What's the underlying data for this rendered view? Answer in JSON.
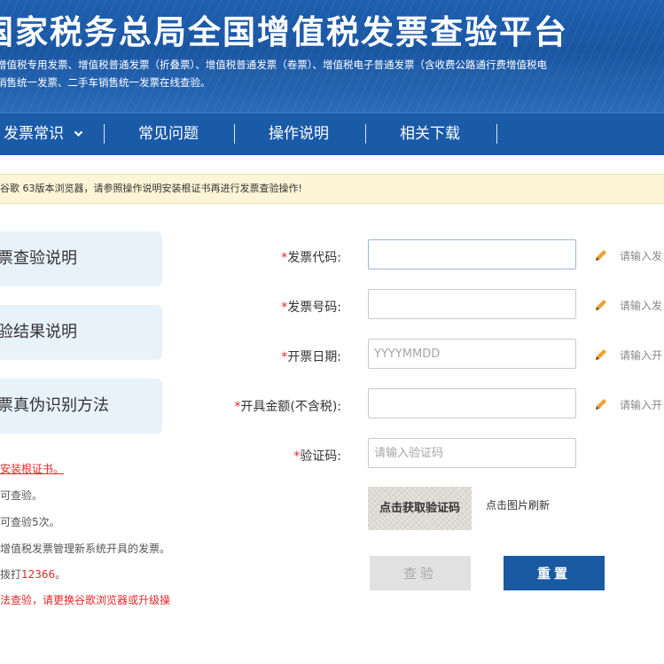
{
  "header": {
    "title": "国家税务总局全国增值税发票查验平台",
    "desc_line1": "增值税专用发票、增值税普通发票（折叠票）、增值税普通发票（卷票）、增值税电子普通发票（含收费公路通行费增值税电",
    "desc_line2": "销售统一发票、二手车销售统一发票在线查验。"
  },
  "nav": {
    "items": [
      {
        "label": "发票常识",
        "icon": "chevron-down-icon"
      },
      {
        "label": "常见问题"
      },
      {
        "label": "操作说明"
      },
      {
        "label": "相关下载"
      }
    ]
  },
  "notice": {
    "text": "谷歌 63版本浏览器，请参照操作说明安装根证书再进行发票查验操作!"
  },
  "sidebar": {
    "cards": [
      {
        "label": "票查验说明"
      },
      {
        "label": "验结果说明"
      },
      {
        "label": "票真伪识别方法"
      }
    ],
    "tips": {
      "t1": "安装根证书。",
      "t2": "可查验。",
      "t3": "可查验5次。",
      "t4": "增值税发票管理新系统开具的发票。",
      "t5_prefix": "拨打",
      "t5_number": "12366",
      "t5_suffix": "。",
      "t6": "法查验，请更换谷歌浏览器或升级操"
    }
  },
  "form": {
    "invoice_code_label": "发票代码:",
    "invoice_code_value": "",
    "invoice_code_hint": "请输入发",
    "invoice_number_label": "发票号码:",
    "invoice_number_value": "",
    "invoice_number_hint": "请输入发",
    "issue_date_label": "开票日期:",
    "issue_date_placeholder": "YYYYMMDD",
    "issue_date_hint": "请输入开",
    "amount_label": "开具金额(不含税):",
    "amount_value": "",
    "amount_hint": "请输入开",
    "captcha_label": "验证码:",
    "captcha_placeholder": "请输入验证码",
    "required_mark": "*",
    "pencil_icon": "pencil-icon",
    "captcha_image_text": "点击获取验证码",
    "captcha_refresh_text": "点击图片刷新",
    "check_button": "查验",
    "reset_button": "重置"
  },
  "colors": {
    "header_blue": "#1d5fae",
    "nav_blue": "#1a5ba8",
    "required_red": "#e8262a",
    "notice_bg": "#fdf5d6",
    "side_card_bg": "#e8f2fb",
    "reset_blue": "#1a5aa2",
    "pencil_orange": "#f0a030"
  }
}
